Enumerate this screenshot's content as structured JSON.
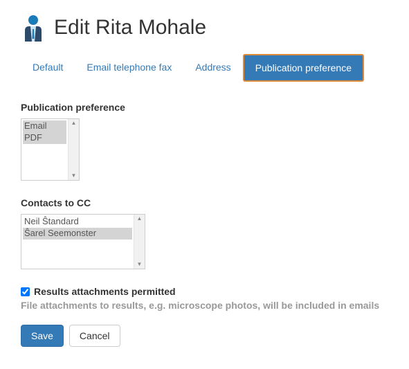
{
  "header": {
    "title": "Edit Rita Mohale"
  },
  "tabs": [
    {
      "label": "Default"
    },
    {
      "label": "Email telephone fax"
    },
    {
      "label": "Address"
    },
    {
      "label": "Publication preference"
    }
  ],
  "fields": {
    "pubpref": {
      "label": "Publication preference",
      "options": [
        "Email",
        "PDF"
      ]
    },
    "contacts": {
      "label": "Contacts to CC",
      "options": [
        "Neil Ŝtandard",
        "Ŝarel Seemonster"
      ]
    },
    "results_attach": {
      "label": "Results attachments permitted",
      "help": "File attachments to results, e.g. microscope photos, will be included in emails"
    }
  },
  "buttons": {
    "save": "Save",
    "cancel": "Cancel"
  }
}
